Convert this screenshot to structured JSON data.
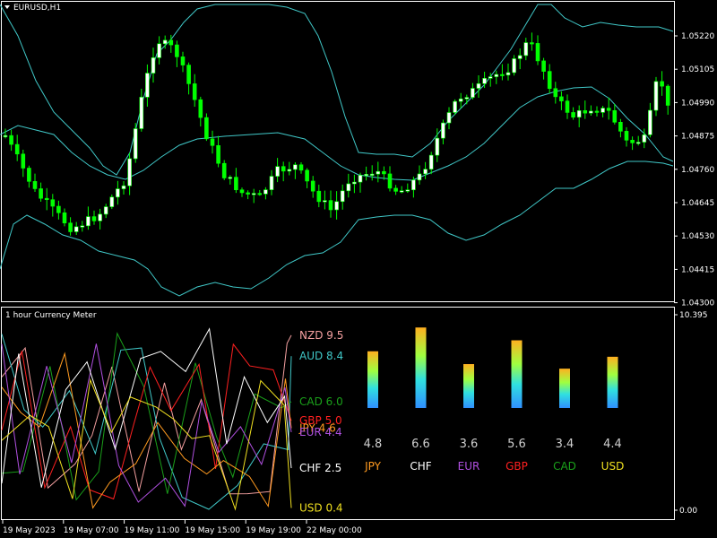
{
  "colors": {
    "background": "#000000",
    "frame": "#ffffff",
    "bull_candle": "#ffffff",
    "bear_candle": "#00ff00",
    "bands": "#40c8c8",
    "axis_text": "#ffffff"
  },
  "main_chart": {
    "label": "EURUSD,H1",
    "menu_icon": "triangle-down-icon",
    "price_labels": [
      "1.05220",
      "1.05105",
      "1.04990",
      "1.04875",
      "1.04760",
      "1.04645",
      "1.04530",
      "1.04415",
      "1.04300"
    ],
    "y_range": [
      1.043,
      1.05335
    ]
  },
  "indicator": {
    "label": "1 hour Currency Meter",
    "scale_labels": [
      "10.395",
      "0.00"
    ],
    "y_range": [
      0,
      10.395
    ],
    "line_labels": [
      {
        "text": "NZD 9.5",
        "color": "#f4a0a0",
        "value": 9.5
      },
      {
        "text": "AUD 8.4",
        "color": "#40c8c8",
        "value": 8.4
      },
      {
        "text": "CAD 6.0",
        "color": "#1aa01a",
        "value": 6.0
      },
      {
        "text": "GBP 5.0",
        "color": "#ff2020",
        "value": 5.0
      },
      {
        "text": "JPY 4.6",
        "color": "#ff9a20",
        "value": 4.6
      },
      {
        "text": "EUR 4.4",
        "color": "#b050e0",
        "value": 4.4
      },
      {
        "text": "CHF 2.5",
        "color": "#ffffff",
        "value": 2.5
      },
      {
        "text": "USD 0.4",
        "color": "#f0e020",
        "value": 0.4
      }
    ],
    "bars": [
      {
        "currency": "JPY",
        "value": "4.8",
        "color": "#ff9a20",
        "strength": 0.62
      },
      {
        "currency": "CHF",
        "value": "6.6",
        "color": "#ffffff",
        "strength": 0.88
      },
      {
        "currency": "EUR",
        "value": "3.6",
        "color": "#b050e0",
        "strength": 0.48
      },
      {
        "currency": "GBP",
        "value": "5.6",
        "color": "#ff2020",
        "strength": 0.74
      },
      {
        "currency": "CAD",
        "value": "3.4",
        "color": "#1aa01a",
        "strength": 0.43
      },
      {
        "currency": "USD",
        "value": "4.4",
        "color": "#f0e020",
        "strength": 0.56
      }
    ]
  },
  "time_labels": [
    "19 May 2023",
    "19 May 07:00",
    "19 May 11:00",
    "19 May 15:00",
    "19 May 19:00",
    "22 May 00:00"
  ]
}
